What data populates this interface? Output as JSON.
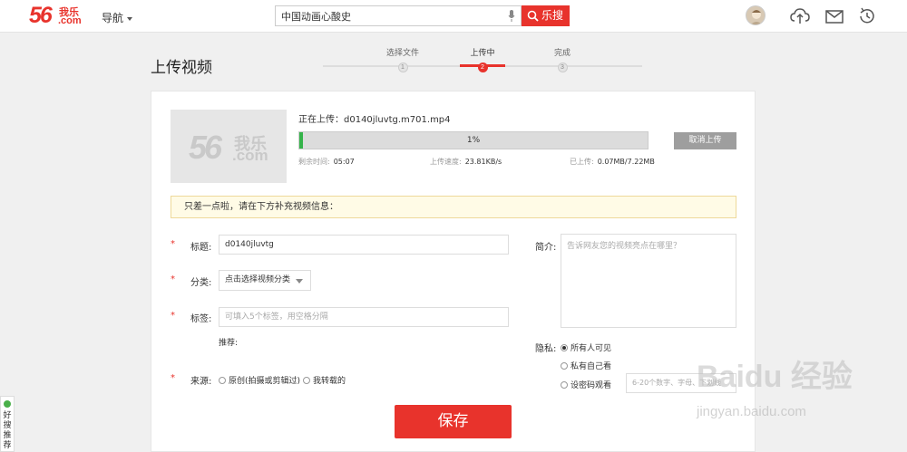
{
  "header": {
    "logo_number": "56",
    "logo_cn": "我乐",
    "logo_com": ".com",
    "nav_label": "导航",
    "search_value": "中国动画心酸史",
    "search_button": "乐搜"
  },
  "page": {
    "title": "上传视频",
    "steps": [
      {
        "label": "选择文件",
        "num": "1"
      },
      {
        "label": "上传中",
        "num": "2"
      },
      {
        "label": "完成",
        "num": "3"
      }
    ],
    "active_step": 2
  },
  "upload": {
    "thumb_number": "56",
    "thumb_cn": "我乐",
    "thumb_com": ".com",
    "uploading_label": "正在上传：d0140jluvtg.m701.mp4",
    "progress_percent": 1,
    "progress_text": "1%",
    "cancel_label": "取消上传",
    "remaining_label": "剩余时间:",
    "remaining_value": "05:07",
    "speed_label": "上传速度:",
    "speed_value": "23.81KB/s",
    "uploaded_label": "已上传:",
    "uploaded_value": "0.07MB/7.22MB"
  },
  "notice": "只差一点啦，请在下方补充视频信息：",
  "form": {
    "required_mark": "*",
    "title_label": "标题:",
    "title_value": "d0140jluvtg",
    "category_label": "分类:",
    "category_value": "点击选择视频分类",
    "tags_label": "标签:",
    "tags_placeholder": "可填入5个标签，用空格分隔",
    "recommend_label": "推荐:",
    "source_label": "来源:",
    "source_options": [
      "原创(拍摄或剪辑过)",
      "我转载的"
    ],
    "intro_label": "简介:",
    "intro_placeholder": "告诉网友您的视频亮点在哪里？",
    "privacy_label": "隐私:",
    "privacy_options": [
      "所有人可见",
      "私有自己看",
      "设密码观看"
    ],
    "password_placeholder": "6-20个数字、字母、下划线",
    "save_label": "保存"
  },
  "side_tab": "好搜推荐",
  "watermark": {
    "line1": "Baidu 经验",
    "line2": "jingyan.baidu.com"
  },
  "colors": {
    "accent": "#e8332c",
    "progress": "#35b34a",
    "notice_bg": "#fffbe6"
  }
}
